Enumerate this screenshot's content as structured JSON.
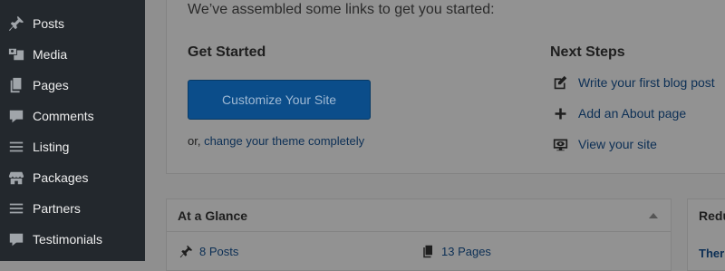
{
  "sidebar": {
    "items": [
      {
        "label": "Posts",
        "icon": "pin-icon"
      },
      {
        "label": "Media",
        "icon": "media-icon"
      },
      {
        "label": "Pages",
        "icon": "pages-icon"
      },
      {
        "label": "Comments",
        "icon": "comment-icon"
      },
      {
        "label": "Listing",
        "icon": "list-icon"
      },
      {
        "label": "Packages",
        "icon": "store-icon"
      },
      {
        "label": "Partners",
        "icon": "list-icon"
      },
      {
        "label": "Testimonials",
        "icon": "comment-icon"
      }
    ]
  },
  "welcome": {
    "intro": "We’ve assembled some links to get you started:",
    "get_started_title": "Get Started",
    "customize_button": "Customize Your Site",
    "or_prefix": "or, ",
    "change_theme_link": "change your theme completely",
    "next_steps_title": "Next Steps",
    "next_steps": [
      {
        "label": "Write your first blog post",
        "icon": "edit-icon"
      },
      {
        "label": "Add an About page",
        "icon": "plus-icon"
      },
      {
        "label": "View your site",
        "icon": "view-site-icon"
      }
    ]
  },
  "at_a_glance": {
    "title": "At a Glance",
    "posts": "8 Posts",
    "pages": "13 Pages"
  },
  "right_box": {
    "title": "Redu",
    "line": "Ther"
  },
  "colors": {
    "sidebar_bg": "#23282d",
    "primary_button": "#0b4d8a",
    "link": "#0c2f55"
  }
}
